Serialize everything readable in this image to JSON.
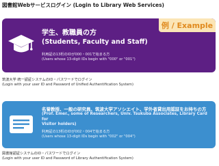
{
  "header": {
    "title": "図書館Webサービスログイン (Login to Library Web Services)"
  },
  "staff_card": {
    "icon": "graduation-cap-icon",
    "title_ja": "学生、教職員の方",
    "title_en": "(Students, Faculty and Staff)",
    "note_ja": "利用証の13桁のIDが000・001で始まる方",
    "note_en": "(Users whose 13-digit IDs begin with \"000\" or \"001\")",
    "example_label": "例 / Example",
    "color": "#5d1f84"
  },
  "staff_caption": {
    "line_ja": "筑波大学 統一認証システムのID・パスワードでログイン",
    "line_en": "(Login with your user ID and Password of Unified Authentification System)"
  },
  "other_card": {
    "icon": "id-card-icon",
    "title_ja": "名誉教授、一般の研究員、筑波大学アソシエイト、学外者貸出用認証をお持ちの方",
    "title_en_line1": "(Prof. Emer., some of Researchers, Univ. Tsukuba Associates, Library Card for",
    "title_en_line2": "Visitor holders)",
    "note_ja": "利用証の13桁のIDが002・004で始まる方",
    "note_en": "(Users whose 13-digit IDs begin with \"002\" or \"004\")",
    "color": "#3c8fcf"
  },
  "other_caption": {
    "line_ja": "図書館認証システムのID・パスワードでログイン",
    "line_en": "(Login with your user ID and Password of Library Authentification System)"
  }
}
